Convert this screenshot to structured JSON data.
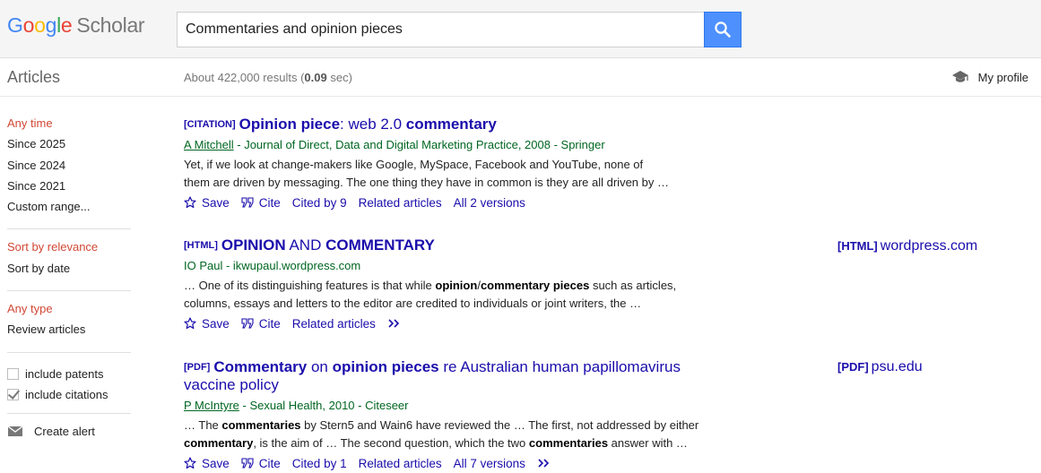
{
  "header": {
    "logo_letters": [
      "G",
      "o",
      "o",
      "g",
      "l",
      "e"
    ],
    "logo_product": "Scholar",
    "search_value": "Commentaries and opinion pieces",
    "search_icon": "search-icon"
  },
  "subheader": {
    "section_title": "Articles",
    "results_prefix": "About 422,000 results (",
    "results_time": "0.09",
    "results_suffix": " sec)",
    "profile_label": "My profile",
    "profile_icon": "graduation-cap-icon"
  },
  "sidebar": {
    "time_filters": [
      "Any time",
      "Since 2025",
      "Since 2024",
      "Since 2021",
      "Custom range..."
    ],
    "sort_options": [
      "Sort by relevance",
      "Sort by date"
    ],
    "type_options": [
      "Any type",
      "Review articles"
    ],
    "checks": [
      {
        "label": "include patents",
        "checked": false
      },
      {
        "label": "include citations",
        "checked": true
      }
    ],
    "alert_label": "Create alert",
    "alert_icon": "envelope-icon"
  },
  "results": [
    {
      "tag": "[CITATION]",
      "title_parts": [
        {
          "text": "Opinion piece",
          "bold": true
        },
        {
          "text": ": web 2.0 ",
          "bold": false
        },
        {
          "text": "commentary",
          "bold": true
        }
      ],
      "author_link": "A Mitchell",
      "source": " - Journal of Direct, Data and Digital Marketing Practice, 2008 - Springer",
      "snippet_lines": [
        [
          {
            "text": "Yet, if we look at change-makers like Google, MySpace, Facebook and YouTube, none of",
            "bold": false
          }
        ],
        [
          {
            "text": "them are driven by messaging. The one thing they have in common is they are all driven by …",
            "bold": false
          }
        ]
      ],
      "links": [
        "Save",
        "Cite",
        "Cited by 9",
        "Related articles",
        "All 2 versions"
      ],
      "has_more": false
    },
    {
      "tag": "[HTML]",
      "title_parts": [
        {
          "text": "OPINION",
          "bold": true
        },
        {
          "text": " AND ",
          "bold": false
        },
        {
          "text": "COMMENTARY",
          "bold": true
        }
      ],
      "author_link": "",
      "source": "IO Paul - ikwupaul.wordpress.com",
      "snippet_lines": [
        [
          {
            "text": "… One of its distinguishing features is that while ",
            "bold": false
          },
          {
            "text": "opinion",
            "bold": true
          },
          {
            "text": "/",
            "bold": false
          },
          {
            "text": "commentary pieces",
            "bold": true
          },
          {
            "text": " such as articles,",
            "bold": false
          }
        ],
        [
          {
            "text": "columns, essays and letters to the editor are credited to individuals or joint writers, the …",
            "bold": false
          }
        ]
      ],
      "links": [
        "Save",
        "Cite",
        "Related articles"
      ],
      "has_more": true,
      "side_tag": "[HTML]",
      "side_domain": "wordpress.com"
    },
    {
      "tag": "[PDF]",
      "title_parts": [
        {
          "text": "Commentary",
          "bold": true
        },
        {
          "text": " on ",
          "bold": false
        },
        {
          "text": "opinion pieces",
          "bold": true
        },
        {
          "text": " re Australian human papillomavirus vaccine policy",
          "bold": false
        }
      ],
      "author_link": "P McIntyre",
      "source": " - Sexual Health, 2010 - Citeseer",
      "snippet_lines": [
        [
          {
            "text": "… The ",
            "bold": false
          },
          {
            "text": "commentaries",
            "bold": true
          },
          {
            "text": " by Stern5 and Wain6 have reviewed the … The first, not addressed by either",
            "bold": false
          }
        ],
        [
          {
            "text": "commentary",
            "bold": true
          },
          {
            "text": ", is the aim of … The second question, which the two ",
            "bold": false
          },
          {
            "text": "commentaries",
            "bold": true
          },
          {
            "text": " answer with …",
            "bold": false
          }
        ]
      ],
      "links": [
        "Save",
        "Cite",
        "Cited by 1",
        "Related articles",
        "All 7 versions"
      ],
      "has_more": true,
      "side_tag": "[PDF]",
      "side_domain": "psu.edu"
    }
  ],
  "colors": {
    "link": "#1a0dab",
    "author_green": "#006621",
    "active_red": "#d14836",
    "search_blue": "#4d90fe"
  }
}
